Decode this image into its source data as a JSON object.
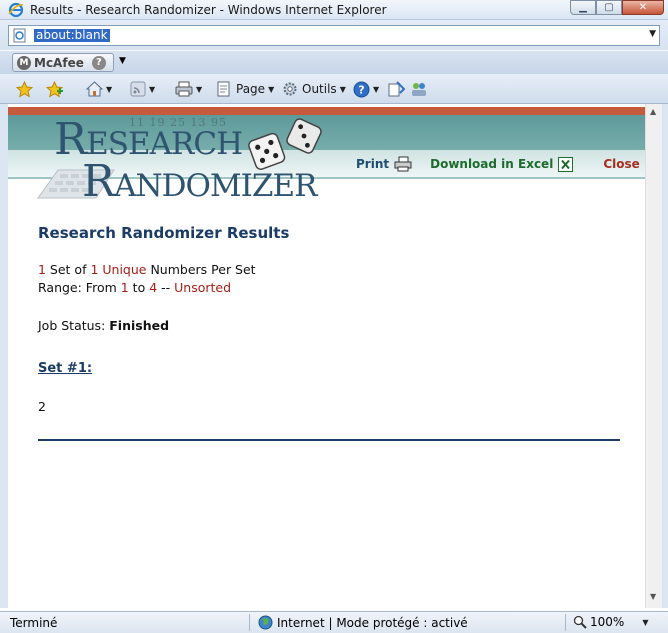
{
  "window": {
    "title": "Results - Research Randomizer - Windows Internet Explorer"
  },
  "address": {
    "url": "about:blank"
  },
  "toolbar": {
    "mcafee_label": "McAfee",
    "page_label": "Page",
    "tools_label": "Outils"
  },
  "banner": {
    "logo_line1_big": "R",
    "logo_line1_rest": "ESEARCH",
    "logo_line2_big": "R",
    "logo_line2_rest": "ANDOMIZER",
    "ghost_numbers": "11 19 25 13 95",
    "print_label": "Print",
    "excel_label": "Download in Excel",
    "close_label": "Close"
  },
  "results": {
    "heading": "Research Randomizer Results",
    "sets_count": "1",
    "set_of": " Set of ",
    "numbers_count": "1",
    "unique": " Unique",
    "numbers_per_set": " Numbers Per Set",
    "range_prefix": "Range: From ",
    "range_from": "1",
    "range_to_word": " to ",
    "range_to": "4",
    "range_sep": " -- ",
    "sort": "Unsorted",
    "job_status_label": "Job Status: ",
    "job_status_value": "Finished",
    "set_link": "Set #1:",
    "set_values": "2"
  },
  "statusbar": {
    "status_text": "Terminé",
    "zone_text": "Internet | Mode protégé : activé",
    "zoom": "100%"
  },
  "colors": {
    "banner_red": "#c55a3c",
    "banner_teal": "#5e9a9a",
    "heading_blue": "#1b3c66",
    "accent_red": "#a61e14"
  }
}
